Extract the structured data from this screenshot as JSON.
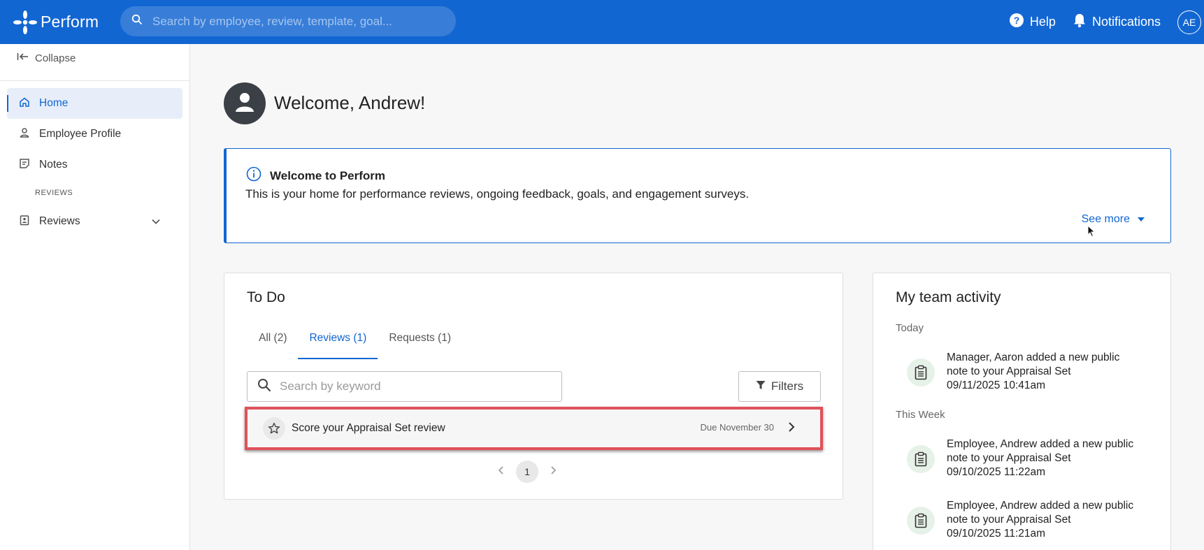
{
  "app": {
    "name": "Perform"
  },
  "header": {
    "search_placeholder": "Search by employee, review, template, goal...",
    "help_label": "Help",
    "notifications_label": "Notifications",
    "avatar_initials": "AE"
  },
  "sidebar": {
    "collapse_label": "Collapse",
    "items": [
      {
        "label": "Home",
        "icon": "home-icon",
        "active": true
      },
      {
        "label": "Employee Profile",
        "icon": "person-icon",
        "active": false
      },
      {
        "label": "Notes",
        "icon": "notes-icon",
        "active": false
      }
    ],
    "section_label": "REVIEWS",
    "reviews_label": "Reviews"
  },
  "main": {
    "welcome_title": "Welcome, Andrew!",
    "info": {
      "title": "Welcome to Perform",
      "text": "This is your home for performance reviews, ongoing feedback, goals, and engagement surveys.",
      "see_more": "See more"
    },
    "todo": {
      "title": "To Do",
      "tabs": [
        {
          "label": "All (2)",
          "active": false
        },
        {
          "label": "Reviews (1)",
          "active": true
        },
        {
          "label": "Requests (1)",
          "active": false
        }
      ],
      "search_placeholder": "Search by keyword",
      "filters_label": "Filters",
      "items": [
        {
          "label": "Score your Appraisal Set review",
          "due": "Due November 30"
        }
      ],
      "current_page": "1"
    },
    "team_activity": {
      "title": "My team activity",
      "groups": [
        {
          "label": "Today",
          "items": [
            {
              "text": "Manager, Aaron added a new public note to your Appraisal Set",
              "time": "09/11/2025 10:41am"
            }
          ]
        },
        {
          "label": "This Week",
          "items": [
            {
              "text": "Employee, Andrew added a new public note to your Appraisal Set",
              "time": "09/10/2025 11:22am"
            },
            {
              "text": "Employee, Andrew added a new public note to your Appraisal Set",
              "time": "09/10/2025 11:21am"
            }
          ]
        }
      ]
    }
  },
  "colors": {
    "brand_blue": "#1266d2",
    "highlight_red": "#e0525a",
    "activity_icon_bg": "#e6f2e8"
  }
}
